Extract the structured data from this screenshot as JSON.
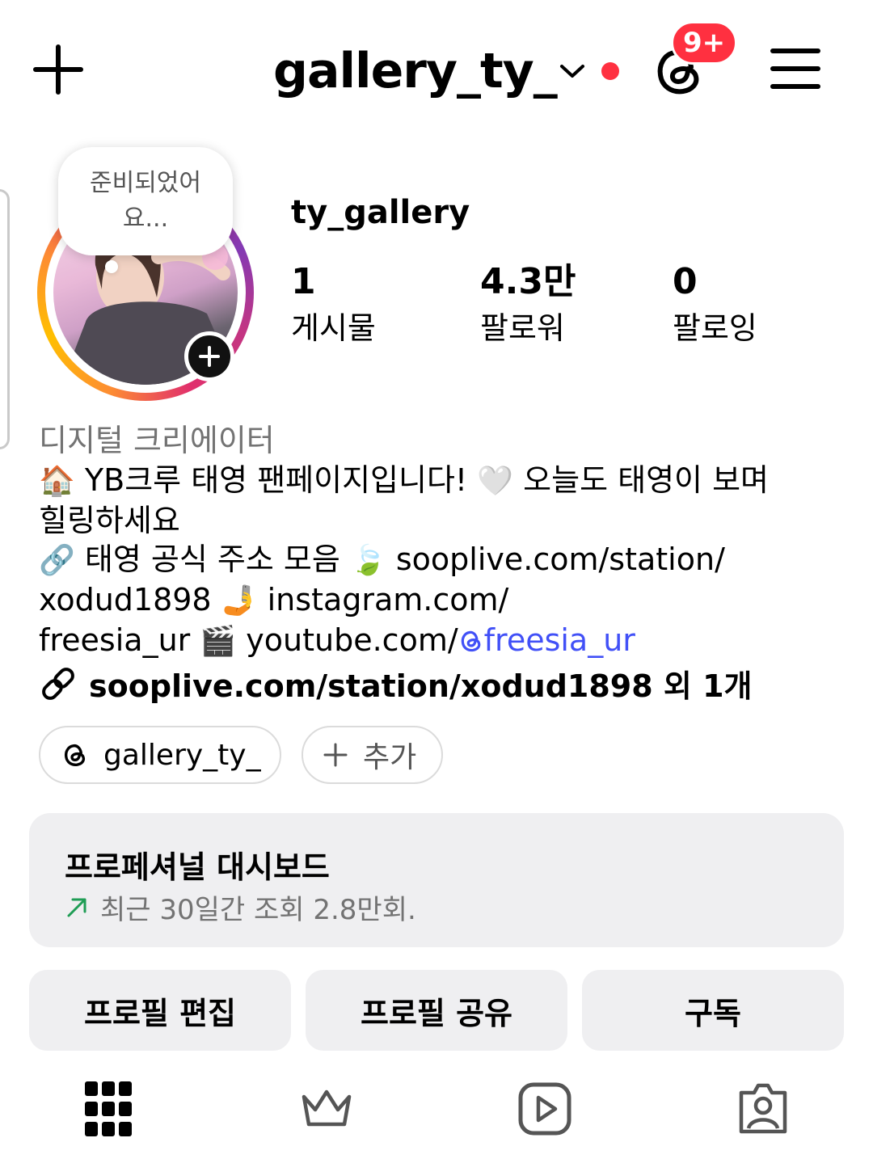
{
  "header": {
    "username": "gallery_ty_",
    "threads_badge": "9+",
    "icons": [
      "plus-icon",
      "chevron-down-icon",
      "threads-icon",
      "menu-icon"
    ]
  },
  "profile": {
    "note_bubble_line1": "준비되었어",
    "note_bubble_line2": "요...",
    "full_name": "ty_gallery",
    "stats": [
      {
        "value": "1",
        "label": "게시물"
      },
      {
        "value": "4.3만",
        "label": "팔로워"
      },
      {
        "value": "0",
        "label": "팔로잉"
      }
    ],
    "category": "디지털 크리에이터",
    "bio": {
      "line1_emoji": "🏠",
      "line1_text": "YB크루 태영 팬페이지입니다!",
      "line1_emoji2": "🤍",
      "line1_text2": "오늘도 태영이 보며",
      "line2": "힐링하세요",
      "line3_emoji": "🔗",
      "line3_text": "태영 공식 주소 모음",
      "line3_emoji2": "🍃",
      "line3_text2": "sooplive.com/station/",
      "line4_text": "xodud1898",
      "line4_emoji": "🤳",
      "line4_text2": "instagram.com/",
      "line5_text": "freesia_ur",
      "line5_emoji": "🎬",
      "line5_text2": "youtube.com/",
      "line5_mention": "freesia_ur"
    },
    "link_text": "sooplive.com/station/xodud1898 외 1개",
    "threads_pill": "gallery_ty_",
    "add_pill": "추가"
  },
  "dashboard": {
    "title": "프로페셔널 대시보드",
    "subtitle": "최근 30일간 조회 2.8만회.",
    "trend_color": "#1f9d55"
  },
  "actions": {
    "edit": "프로필 편집",
    "share": "프로필 공유",
    "subscribe": "구독"
  },
  "tabs": [
    "grid-icon",
    "crown-icon",
    "reels-icon",
    "tagged-icon"
  ],
  "colors": {
    "badge": "#ff3040",
    "mention": "#4150f7",
    "button_bg": "#efeff1"
  }
}
